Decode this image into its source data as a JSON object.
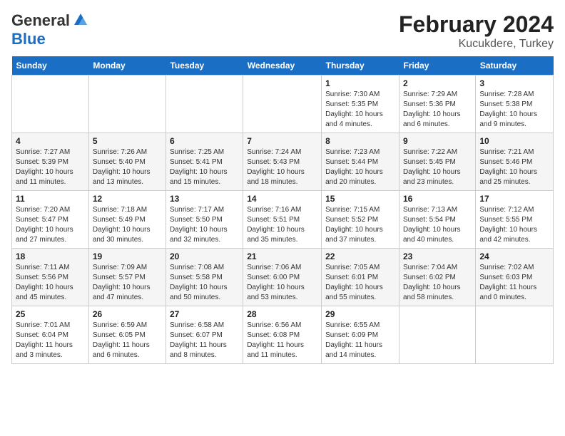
{
  "header": {
    "logo_general": "General",
    "logo_blue": "Blue",
    "title": "February 2024",
    "subtitle": "Kucukdere, Turkey"
  },
  "days_of_week": [
    "Sunday",
    "Monday",
    "Tuesday",
    "Wednesday",
    "Thursday",
    "Friday",
    "Saturday"
  ],
  "weeks": [
    [
      {
        "day": "",
        "info": ""
      },
      {
        "day": "",
        "info": ""
      },
      {
        "day": "",
        "info": ""
      },
      {
        "day": "",
        "info": ""
      },
      {
        "day": "1",
        "info": "Sunrise: 7:30 AM\nSunset: 5:35 PM\nDaylight: 10 hours\nand 4 minutes."
      },
      {
        "day": "2",
        "info": "Sunrise: 7:29 AM\nSunset: 5:36 PM\nDaylight: 10 hours\nand 6 minutes."
      },
      {
        "day": "3",
        "info": "Sunrise: 7:28 AM\nSunset: 5:38 PM\nDaylight: 10 hours\nand 9 minutes."
      }
    ],
    [
      {
        "day": "4",
        "info": "Sunrise: 7:27 AM\nSunset: 5:39 PM\nDaylight: 10 hours\nand 11 minutes."
      },
      {
        "day": "5",
        "info": "Sunrise: 7:26 AM\nSunset: 5:40 PM\nDaylight: 10 hours\nand 13 minutes."
      },
      {
        "day": "6",
        "info": "Sunrise: 7:25 AM\nSunset: 5:41 PM\nDaylight: 10 hours\nand 15 minutes."
      },
      {
        "day": "7",
        "info": "Sunrise: 7:24 AM\nSunset: 5:43 PM\nDaylight: 10 hours\nand 18 minutes."
      },
      {
        "day": "8",
        "info": "Sunrise: 7:23 AM\nSunset: 5:44 PM\nDaylight: 10 hours\nand 20 minutes."
      },
      {
        "day": "9",
        "info": "Sunrise: 7:22 AM\nSunset: 5:45 PM\nDaylight: 10 hours\nand 23 minutes."
      },
      {
        "day": "10",
        "info": "Sunrise: 7:21 AM\nSunset: 5:46 PM\nDaylight: 10 hours\nand 25 minutes."
      }
    ],
    [
      {
        "day": "11",
        "info": "Sunrise: 7:20 AM\nSunset: 5:47 PM\nDaylight: 10 hours\nand 27 minutes."
      },
      {
        "day": "12",
        "info": "Sunrise: 7:18 AM\nSunset: 5:49 PM\nDaylight: 10 hours\nand 30 minutes."
      },
      {
        "day": "13",
        "info": "Sunrise: 7:17 AM\nSunset: 5:50 PM\nDaylight: 10 hours\nand 32 minutes."
      },
      {
        "day": "14",
        "info": "Sunrise: 7:16 AM\nSunset: 5:51 PM\nDaylight: 10 hours\nand 35 minutes."
      },
      {
        "day": "15",
        "info": "Sunrise: 7:15 AM\nSunset: 5:52 PM\nDaylight: 10 hours\nand 37 minutes."
      },
      {
        "day": "16",
        "info": "Sunrise: 7:13 AM\nSunset: 5:54 PM\nDaylight: 10 hours\nand 40 minutes."
      },
      {
        "day": "17",
        "info": "Sunrise: 7:12 AM\nSunset: 5:55 PM\nDaylight: 10 hours\nand 42 minutes."
      }
    ],
    [
      {
        "day": "18",
        "info": "Sunrise: 7:11 AM\nSunset: 5:56 PM\nDaylight: 10 hours\nand 45 minutes."
      },
      {
        "day": "19",
        "info": "Sunrise: 7:09 AM\nSunset: 5:57 PM\nDaylight: 10 hours\nand 47 minutes."
      },
      {
        "day": "20",
        "info": "Sunrise: 7:08 AM\nSunset: 5:58 PM\nDaylight: 10 hours\nand 50 minutes."
      },
      {
        "day": "21",
        "info": "Sunrise: 7:06 AM\nSunset: 6:00 PM\nDaylight: 10 hours\nand 53 minutes."
      },
      {
        "day": "22",
        "info": "Sunrise: 7:05 AM\nSunset: 6:01 PM\nDaylight: 10 hours\nand 55 minutes."
      },
      {
        "day": "23",
        "info": "Sunrise: 7:04 AM\nSunset: 6:02 PM\nDaylight: 10 hours\nand 58 minutes."
      },
      {
        "day": "24",
        "info": "Sunrise: 7:02 AM\nSunset: 6:03 PM\nDaylight: 11 hours\nand 0 minutes."
      }
    ],
    [
      {
        "day": "25",
        "info": "Sunrise: 7:01 AM\nSunset: 6:04 PM\nDaylight: 11 hours\nand 3 minutes."
      },
      {
        "day": "26",
        "info": "Sunrise: 6:59 AM\nSunset: 6:05 PM\nDaylight: 11 hours\nand 6 minutes."
      },
      {
        "day": "27",
        "info": "Sunrise: 6:58 AM\nSunset: 6:07 PM\nDaylight: 11 hours\nand 8 minutes."
      },
      {
        "day": "28",
        "info": "Sunrise: 6:56 AM\nSunset: 6:08 PM\nDaylight: 11 hours\nand 11 minutes."
      },
      {
        "day": "29",
        "info": "Sunrise: 6:55 AM\nSunset: 6:09 PM\nDaylight: 11 hours\nand 14 minutes."
      },
      {
        "day": "",
        "info": ""
      },
      {
        "day": "",
        "info": ""
      }
    ]
  ]
}
